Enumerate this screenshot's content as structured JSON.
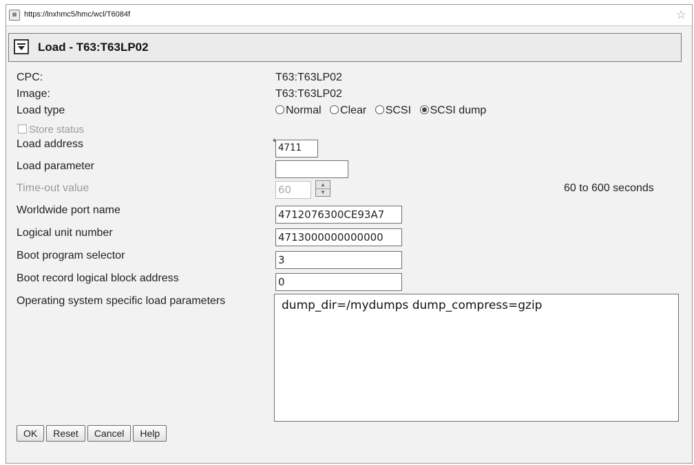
{
  "browser": {
    "url": "https://lnxhmc5/hmc/wcl/T6084f",
    "site_icon": "page-icon",
    "bookmark_icon": "star-icon"
  },
  "dialog": {
    "title": "Load - T63:T63LP02",
    "collapse_icon": "chevron-down-icon"
  },
  "form": {
    "cpc": {
      "label": "CPC:",
      "value": "T63:T63LP02"
    },
    "image": {
      "label": "Image:",
      "value": "T63:T63LP02"
    },
    "load_type": {
      "label": "Load type",
      "options": [
        {
          "label": "Normal",
          "selected": false
        },
        {
          "label": "Clear",
          "selected": false
        },
        {
          "label": "SCSI",
          "selected": false
        },
        {
          "label": "SCSI dump",
          "selected": true
        }
      ]
    },
    "store_status": {
      "label": "Store status",
      "checked": false,
      "disabled": true
    },
    "load_address": {
      "label": "Load address",
      "value": "4711",
      "required_mark": "*"
    },
    "load_parameter": {
      "label": "Load parameter",
      "value": ""
    },
    "timeout": {
      "label": "Time-out value",
      "value": "60",
      "range_note": "60 to 600 seconds",
      "disabled": true
    },
    "wwpn": {
      "label": "Worldwide port name",
      "value": "4712076300CE93A7"
    },
    "lun": {
      "label": "Logical unit number",
      "value": "4713000000000000"
    },
    "boot_program_selector": {
      "label": "Boot program selector",
      "value": "3"
    },
    "boot_record_lba": {
      "label": "Boot record logical block address",
      "value": "0"
    },
    "os_load_params": {
      "label": "Operating system specific load parameters",
      "value": "dump_dir=/mydumps dump_compress=gzip"
    }
  },
  "buttons": {
    "ok": "OK",
    "reset": "Reset",
    "cancel": "Cancel",
    "help": "Help"
  }
}
